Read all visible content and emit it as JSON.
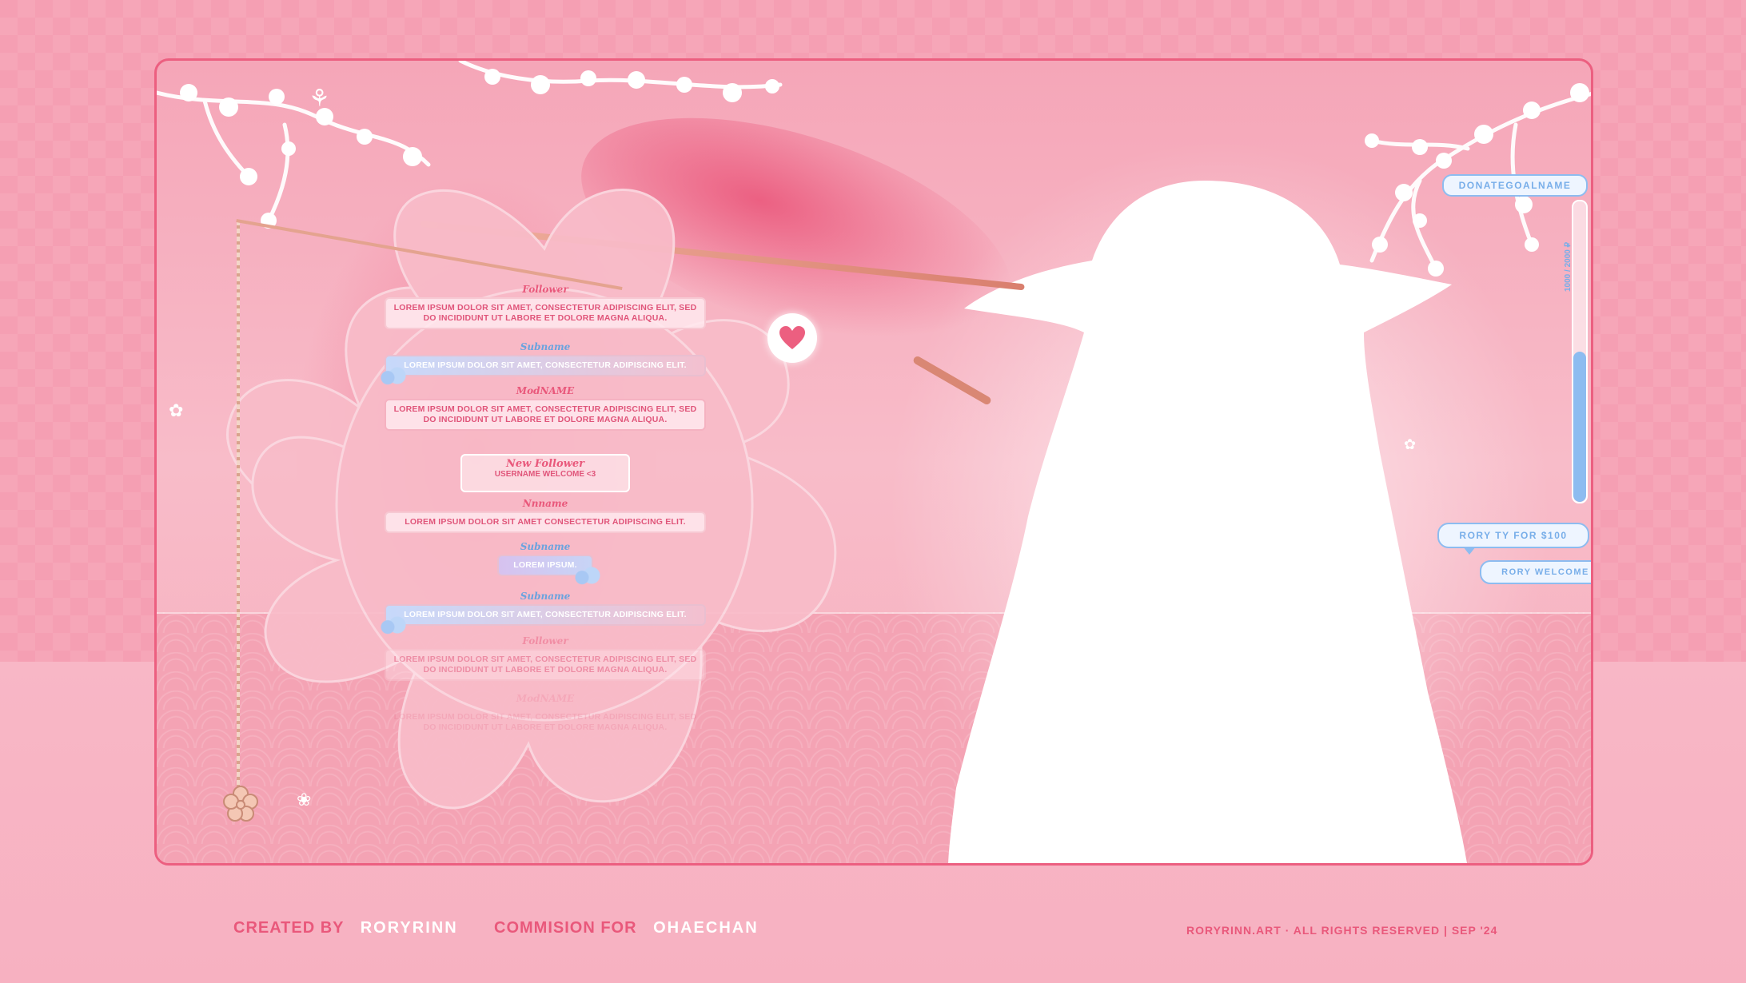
{
  "chat": {
    "messages": [
      {
        "name": "Follower",
        "text": "Lorem ipsum dolor sit amet, consectetur adipiscing elit, sed do incididunt ut labore et dolore magna aliqua.",
        "kind": "follower"
      },
      {
        "name": "Subname",
        "text": "Lorem ipsum dolor sit amet, consectetur adipiscing elit.",
        "kind": "sub"
      },
      {
        "name": "ModNAME",
        "text": "Lorem ipsum dolor sit amet, consectetur adipiscing elit, sed do incididunt ut labore et dolore magna aliqua.",
        "kind": "mod"
      },
      {
        "name": "Nnname",
        "text": "Lorem ipsum dolor sit amet consectetur adipiscing elit.",
        "kind": "follower"
      },
      {
        "name": "Subname",
        "text": "Lorem ipsum dolor sit amet, consectetur adipiscing elit.",
        "kind": "sub"
      },
      {
        "name": "Follower",
        "text": "Lorem ipsum dolor sit amet, consectetur adipiscing elit, sed do incididunt ut labore et dolore magna aliqua.",
        "kind": "follower"
      },
      {
        "name": "ModNAME",
        "text": "Lorem ipsum dolor sit amet, consectetur adipiscing elit, sed do incididunt ut labore et dolore magna aliqua.",
        "kind": "mod"
      }
    ],
    "new_follower": {
      "title": "New Follower",
      "text": "USERNAME WELCOME <3"
    },
    "sub_small": {
      "name": "Subname",
      "text": "LOREM IPSUM."
    }
  },
  "donation_goal": {
    "name": "DONATEGOALNAME",
    "amount": "1000 / 2000 ₽",
    "progress": 0.5
  },
  "alerts": {
    "primary": "RORY TY FOR $100",
    "secondary": "RORY WELCOME"
  },
  "footer": {
    "created_label": "CREATED BY",
    "created_value": "RORYRINN",
    "commission_label": "COMMISION FOR",
    "commission_value": "OHAECHAN",
    "rights": "RORYRINN.ART  ·  ALL RIGHTS RESERVED  |  SEP '24"
  },
  "colors": {
    "accent_pink": "#e9587b",
    "accent_blue": "#8dbcf0",
    "frame_border": "#ec5f80"
  },
  "icons": [
    "heart-icon",
    "cherry-blossom-icon",
    "butterfly-icon",
    "strawberry-icon",
    "cloud-icon"
  ]
}
